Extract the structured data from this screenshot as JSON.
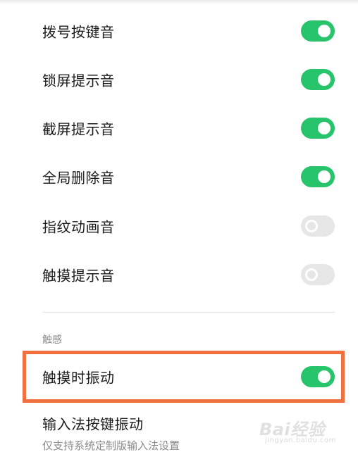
{
  "settings": [
    {
      "label": "拨号按键音",
      "enabled": true
    },
    {
      "label": "锁屏提示音",
      "enabled": true
    },
    {
      "label": "截屏提示音",
      "enabled": true
    },
    {
      "label": "全局删除音",
      "enabled": true
    },
    {
      "label": "指纹动画音",
      "enabled": false
    },
    {
      "label": "触摸提示音",
      "enabled": false
    }
  ],
  "haptics_section": {
    "header": "触感",
    "items": [
      {
        "label": "触摸时振动",
        "enabled": true
      },
      {
        "label": "输入法按键振动",
        "sublabel": "仅支持系统定制版输入法设置"
      }
    ]
  },
  "colors": {
    "toggle_on": "#27c46b",
    "toggle_off": "#e6e6e6",
    "highlight_frame": "#f07040"
  },
  "watermark": {
    "brand": "Bai经验",
    "domain": "jingyan.baidu.com"
  }
}
